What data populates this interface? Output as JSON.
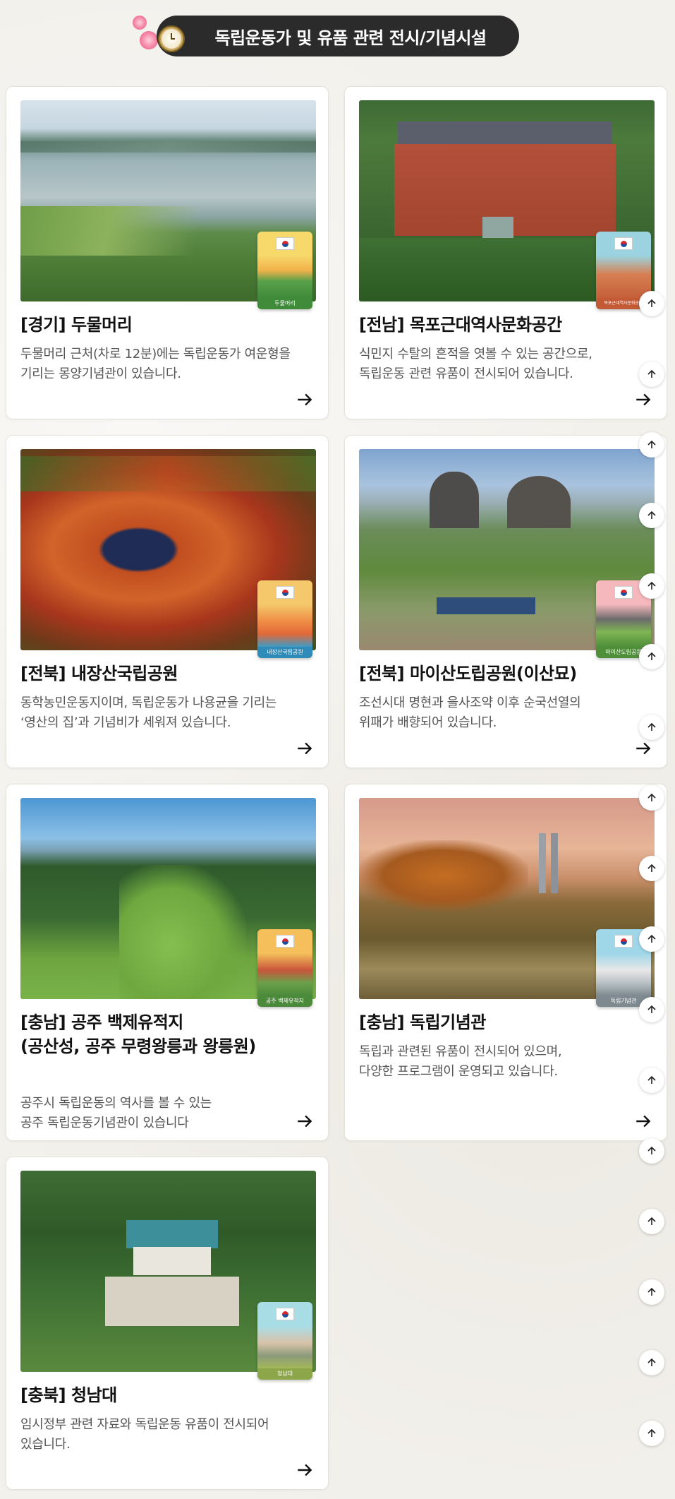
{
  "header": {
    "title": "독립운동가 및 유품 관련 전시/기념시설"
  },
  "cards": [
    {
      "title": "[경기] 두물머리",
      "desc_line1": "두물머리 근처(차로 12분)에는 독립운동가 여운형을",
      "desc_line2": "기리는 몽양기념관이 있습니다.",
      "badge": "두물머리"
    },
    {
      "title": "[전남] 목포근대역사문화공간",
      "desc_line1": "식민지 수탈의 흔적을 엿볼 수 있는 공간으로,",
      "desc_line2": "독립운동 관련 유품이 전시되어 있습니다.",
      "badge": "목포근대역사문화공간"
    },
    {
      "title": "[전북] 내장산국립공원",
      "desc_line1": "동학농민운동지이며, 독립운동가 나용균을 기리는",
      "desc_line2": "‘영산의 집’과 기념비가 세워져 있습니다.",
      "badge": "내장산국립공원"
    },
    {
      "title": "[전북] 마이산도립공원(이산묘)",
      "desc_line1": "조선시대 명현과 을사조약 이후 순국선열의",
      "desc_line2": "위패가 배향되어 있습니다.",
      "badge": "마이산도립공원"
    },
    {
      "title_line1": "[충남] 공주 백제유적지",
      "title_line2": "(공산성, 공주 무령왕릉과 왕릉원)",
      "desc_line1": "공주시 독립운동의 역사를 볼 수 있는",
      "desc_line2": "공주 독립운동기념관이 있습니다",
      "badge": "공주 백제유적지"
    },
    {
      "title": "[충남] 독립기념관",
      "desc_line1": "독립과 관련된 유품이 전시되어 있으며,",
      "desc_line2": "다양한 프로그램이 운영되고 있습니다.",
      "badge": "독립기념관"
    },
    {
      "title": "[충북] 청남대",
      "desc_line1": "임시정부 관련 자료와 독립운동 유품이 전시되어",
      "desc_line2": "있습니다.",
      "badge": "청남대"
    }
  ],
  "icons": {
    "arrow": "arrow-right-icon",
    "top": "arrow-up-icon",
    "flag": "korean-flag-icon",
    "watch": "pocket-watch-icon"
  },
  "colors": {
    "header_bg": "#2b2b2b",
    "page_bg": "#f3f1ec",
    "card_bg": "#ffffff",
    "text": "#111111",
    "desc": "#555555"
  }
}
